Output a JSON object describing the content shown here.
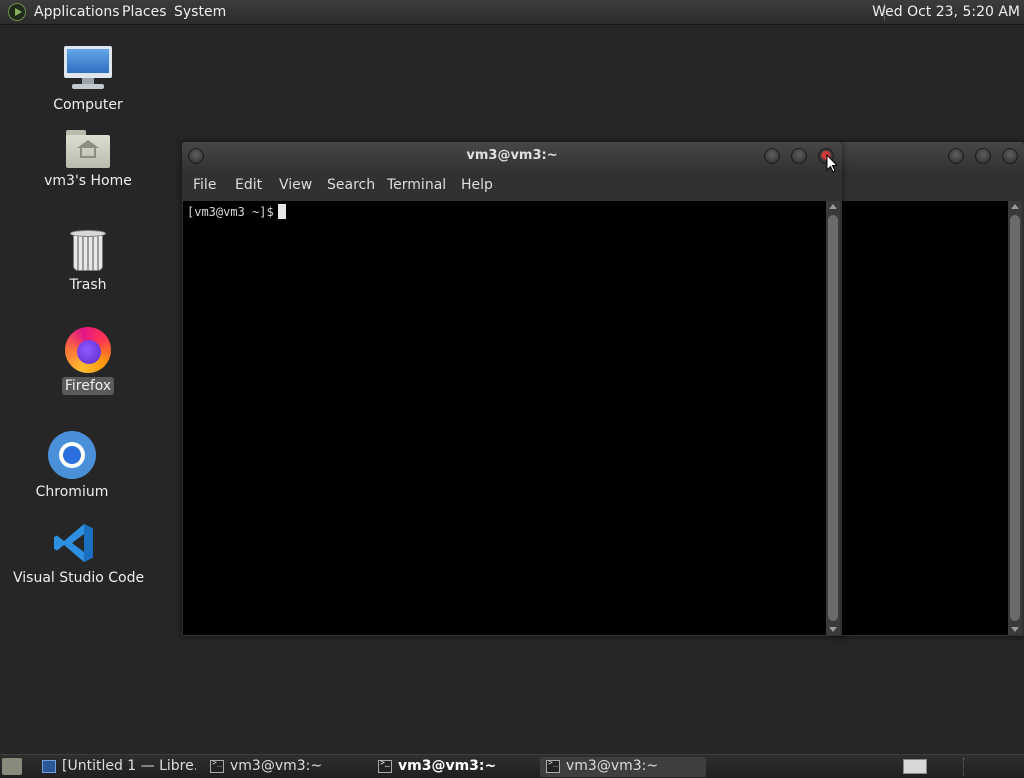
{
  "top_panel": {
    "menus": [
      "Applications",
      "Places",
      "System"
    ],
    "clock": "Wed Oct 23,  5:20 AM"
  },
  "desktop_icons": [
    {
      "label": "Computer",
      "icon": "computer-icon"
    },
    {
      "label": "vm3's Home",
      "icon": "home-folder-icon"
    },
    {
      "label": "Trash",
      "icon": "trash-icon"
    },
    {
      "label": "Firefox",
      "icon": "firefox-icon",
      "selected": true
    },
    {
      "label": "Chromium",
      "icon": "chromium-icon"
    },
    {
      "label": "Visual Studio Code",
      "icon": "vscode-icon"
    }
  ],
  "terminal_window": {
    "title": "vm3@vm3:~",
    "menu": [
      "File",
      "Edit",
      "View",
      "Search",
      "Terminal",
      "Help"
    ],
    "prompt": "[vm3@vm3 ~]$"
  },
  "taskbar": {
    "tasks": [
      {
        "label": "[Untitled 1 — Libre...",
        "icon": "writer-icon"
      },
      {
        "label": "vm3@vm3:~",
        "icon": "terminal-icon"
      },
      {
        "label": "vm3@vm3:~",
        "icon": "terminal-icon",
        "active": true
      },
      {
        "label": "vm3@vm3:~",
        "icon": "terminal-icon"
      }
    ]
  },
  "colors": {
    "desktop_bg": "#262626",
    "terminal_bg": "#000000",
    "close_button": "#d23a3a"
  }
}
